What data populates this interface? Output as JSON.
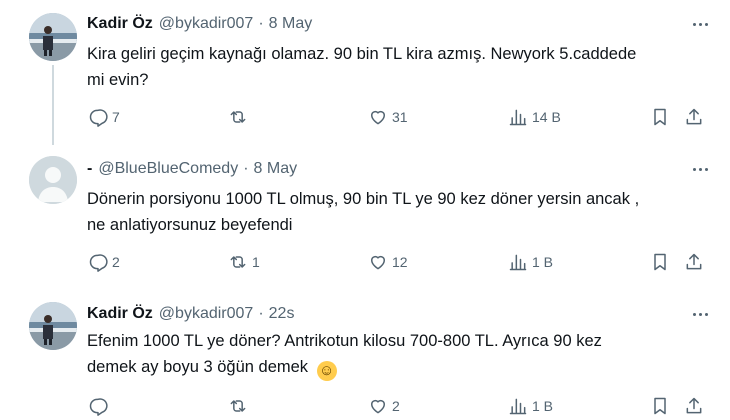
{
  "tweets": [
    {
      "name": "Kadir Öz",
      "handle": "@bykadir007",
      "sep": "·",
      "time": "8 May",
      "text_line1": "Kira geliri geçim kaynağı olamaz. 90 bin TL kira azmış. Newyork 5.caddede",
      "text_line2": "mi evin?",
      "replies": "7",
      "reposts": "",
      "likes": "31",
      "views": "14 B"
    },
    {
      "name": "-",
      "handle": "@BlueBlueComedy",
      "sep": "·",
      "time": "8 May",
      "text_line1": "Dönerin porsiyonu 1000 TL olmuş, 90 bin TL ye 90 kez döner yersin ancak ,",
      "text_line2": "ne anlatiyorsunuz beyefendi",
      "replies": "2",
      "reposts": "1",
      "likes": "12",
      "views": "1 B"
    },
    {
      "name": "Kadir Öz",
      "handle": "@bykadir007",
      "sep": "·",
      "time": "22s",
      "text_line1": "Efenim 1000 TL ye döner? Antrikotun kilosu 700-800 TL. Ayrıca 90 kez",
      "text_line2": "demek ay boyu 3 öğün demek",
      "emoji": "☺",
      "replies": "",
      "reposts": "",
      "likes": "2",
      "views": "1 B"
    }
  ],
  "icons": {
    "reply": "reply-icon",
    "repost": "repost-icon",
    "like": "heart-icon",
    "views": "views-icon",
    "bookmark": "bookmark-icon",
    "share": "share-icon",
    "more": "more-icon"
  },
  "colors": {
    "text": "#0f1419",
    "secondary": "#536471",
    "thread_line": "#cfd9de",
    "default_avatar_bg": "#cfd9de"
  }
}
